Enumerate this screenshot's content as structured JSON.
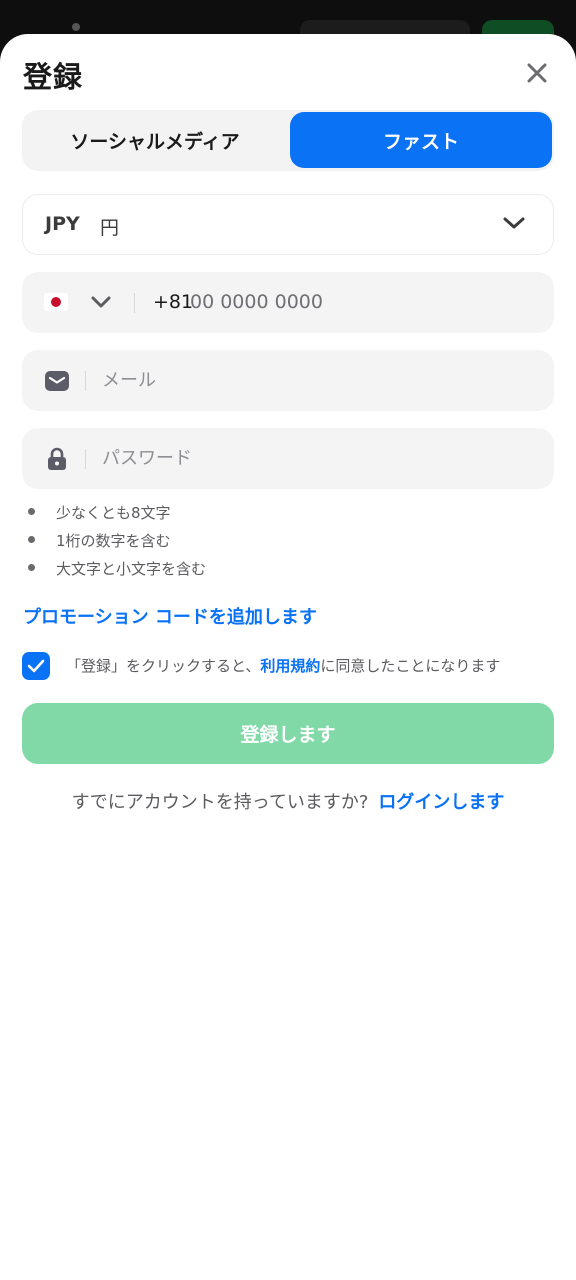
{
  "modal": {
    "title": "登録"
  },
  "tabs": [
    {
      "label": "ソーシャルメディア",
      "selected": false
    },
    {
      "label": "ファスト",
      "selected": true
    }
  ],
  "currency": {
    "code": "JPY",
    "name": "円"
  },
  "phone": {
    "country_flag": "japan-flag",
    "prefix": "+81",
    "placeholder": "00 0000 0000",
    "value": ""
  },
  "email": {
    "placeholder": "メール",
    "value": ""
  },
  "password": {
    "placeholder": "パスワード",
    "value": ""
  },
  "password_rules": [
    "少なくとも8文字",
    "1桁の数字を含む",
    "大文字と小文字を含む"
  ],
  "promo_link": "プロモーション コードを追加します",
  "terms": {
    "checked": true,
    "prefix": "「登録」をクリックすると、",
    "link": "利用規約",
    "suffix": "に同意したことになります"
  },
  "submit_label": "登録します",
  "login": {
    "question": "すでにアカウントを持っていますか?",
    "link": "ログインします"
  },
  "colors": {
    "accent": "#0a72f5",
    "submit_disabled": "#82d9a8",
    "field_bg": "#f4f4f5"
  },
  "icons": {
    "close": "close-icon",
    "dropdown": "chevron-down-icon",
    "email": "envelope-icon",
    "password": "lock-icon",
    "checkbox": "checkmark-icon"
  }
}
